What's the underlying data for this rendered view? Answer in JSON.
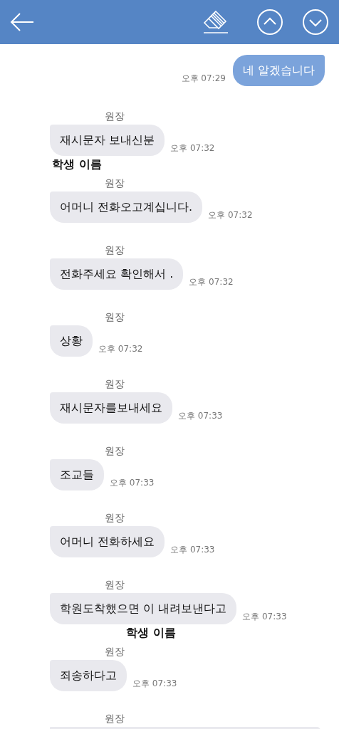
{
  "messages": [
    {
      "kind": "outgoing",
      "text": "네 알겠습니다",
      "time": "오후 07:29"
    },
    {
      "kind": "incoming",
      "sender": "원장",
      "text": "재시문자 보내신분",
      "time": "오후 07:32",
      "annotation": "학생 이름"
    },
    {
      "kind": "incoming",
      "sender": "원장",
      "text": "어머니 전화오고계십니다.",
      "time": "오후 07:32"
    },
    {
      "kind": "incoming",
      "sender": "원장",
      "text": "전화주세요 확인해서 .",
      "time": "오후 07:32"
    },
    {
      "kind": "incoming",
      "sender": "원장",
      "text": "상황",
      "time": "오후 07:32"
    },
    {
      "kind": "incoming",
      "sender": "원장",
      "text": "재시문자를보내세요",
      "time": "오후 07:33"
    },
    {
      "kind": "incoming",
      "sender": "원장",
      "text": "조교들",
      "time": "오후 07:33"
    },
    {
      "kind": "incoming",
      "sender": "원장",
      "text": "어머니 전화하세요",
      "time": "오후 07:33"
    },
    {
      "kind": "incoming",
      "sender": "원장",
      "text": "학원도착했으면 이 내려보낸다고",
      "time": "오후 07:33",
      "annotation": "학생 이름"
    },
    {
      "kind": "incoming",
      "sender": "원장",
      "text": "죄송하다고",
      "time": "오후 07:33"
    },
    {
      "kind": "incoming",
      "sender": "원장"
    }
  ]
}
